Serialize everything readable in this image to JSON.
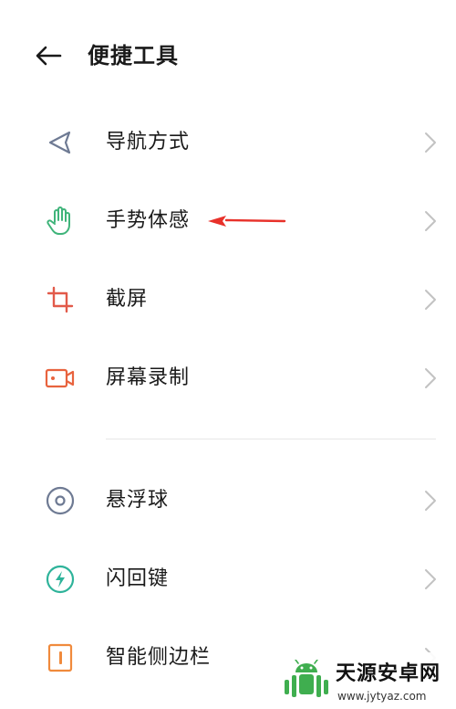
{
  "header": {
    "title": "便捷工具",
    "back_icon": "arrow-left-icon"
  },
  "items": [
    {
      "label": "导航方式",
      "icon": "navigation-icon",
      "color": "#6e7a93"
    },
    {
      "label": "手势体感",
      "icon": "hand-gesture-icon",
      "color": "#3fb47a"
    },
    {
      "label": "截屏",
      "icon": "crop-icon",
      "color": "#e25a4a"
    },
    {
      "label": "屏幕录制",
      "icon": "video-record-icon",
      "color": "#e8633e"
    },
    {
      "label": "悬浮球",
      "icon": "float-ball-icon",
      "color": "#6e7a93"
    },
    {
      "label": "闪回键",
      "icon": "flash-back-icon",
      "color": "#2eb39a"
    },
    {
      "label": "智能侧边栏",
      "icon": "sidebar-icon",
      "color": "#f08a3c"
    }
  ],
  "annotation": {
    "color": "#e8312a"
  },
  "watermark": {
    "name": "天源安卓网",
    "url": "www.jytyaz.com"
  },
  "colors": {
    "chevron": "#c2c2c2",
    "divider": "#e6e6e6",
    "text": "#1a1a1a"
  }
}
